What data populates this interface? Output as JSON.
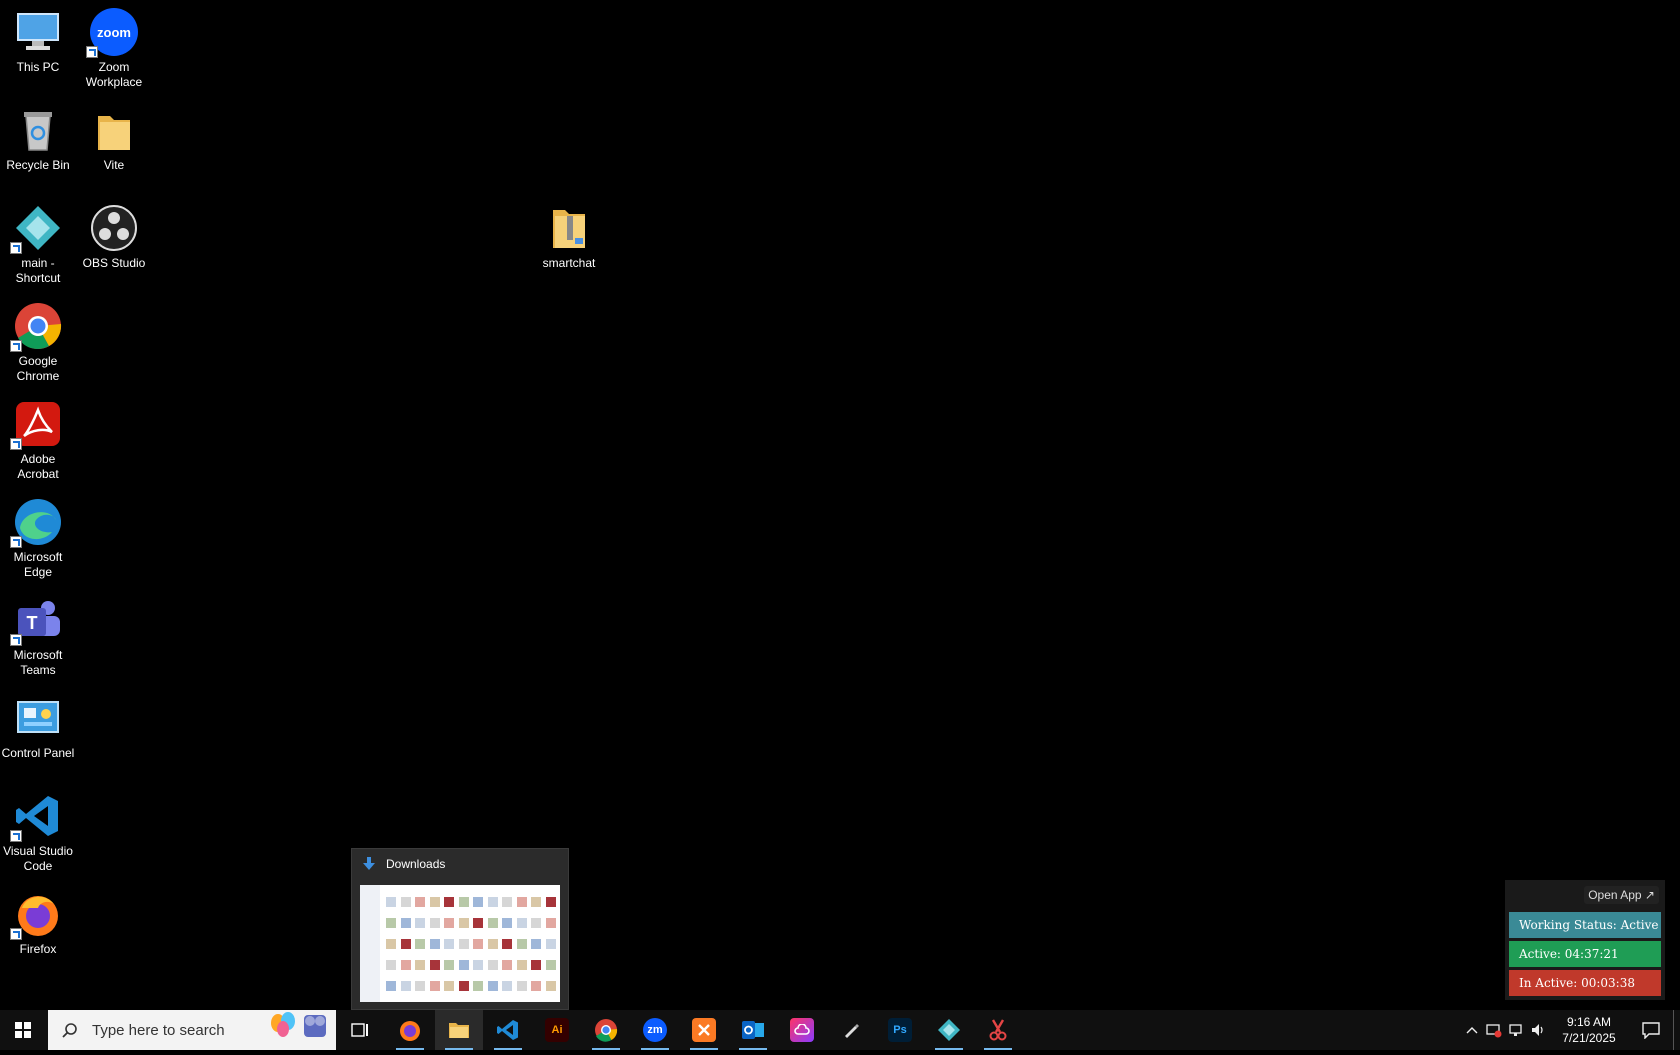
{
  "desktop": {
    "icons": [
      {
        "label": "This PC"
      },
      {
        "label": "Zoom\nWorkplace"
      },
      {
        "label": "Recycle Bin"
      },
      {
        "label": "Vite"
      },
      {
        "label": "main -\nShortcut"
      },
      {
        "label": "OBS Studio"
      },
      {
        "label": "smartchat"
      },
      {
        "label": "Google\nChrome"
      },
      {
        "label": "Adobe\nAcrobat"
      },
      {
        "label": "Microsoft\nEdge"
      },
      {
        "label": "Microsoft\nTeams"
      },
      {
        "label": "Control Panel"
      },
      {
        "label": "Visual Studio\nCode"
      },
      {
        "label": "Firefox"
      }
    ],
    "zoom_logo_text": "zoom"
  },
  "preview": {
    "title": "Downloads"
  },
  "tracker": {
    "open_app": "Open App ↗",
    "status": "Working Status: Active",
    "active": "Active: 04:37:21",
    "inactive": "In Active: 00:03:38",
    "colors": {
      "status": "#3a8a96",
      "active": "#1f9d55",
      "inactive": "#c0392b"
    }
  },
  "taskbar": {
    "search_placeholder": "Type here to search",
    "apps": [
      {
        "name": "task-view"
      },
      {
        "name": "firefox"
      },
      {
        "name": "file-explorer"
      },
      {
        "name": "visual-studio-code"
      },
      {
        "name": "adobe-illustrator",
        "glyph": "Ai"
      },
      {
        "name": "google-chrome"
      },
      {
        "name": "zoom",
        "glyph": "zm"
      },
      {
        "name": "xampp"
      },
      {
        "name": "outlook"
      },
      {
        "name": "creative-cloud"
      },
      {
        "name": "pen-tool"
      },
      {
        "name": "photoshop",
        "glyph": "Ps"
      },
      {
        "name": "main-app"
      },
      {
        "name": "snipping-tool"
      }
    ],
    "clock": {
      "time": "9:16 AM",
      "date": "7/21/2025"
    }
  }
}
